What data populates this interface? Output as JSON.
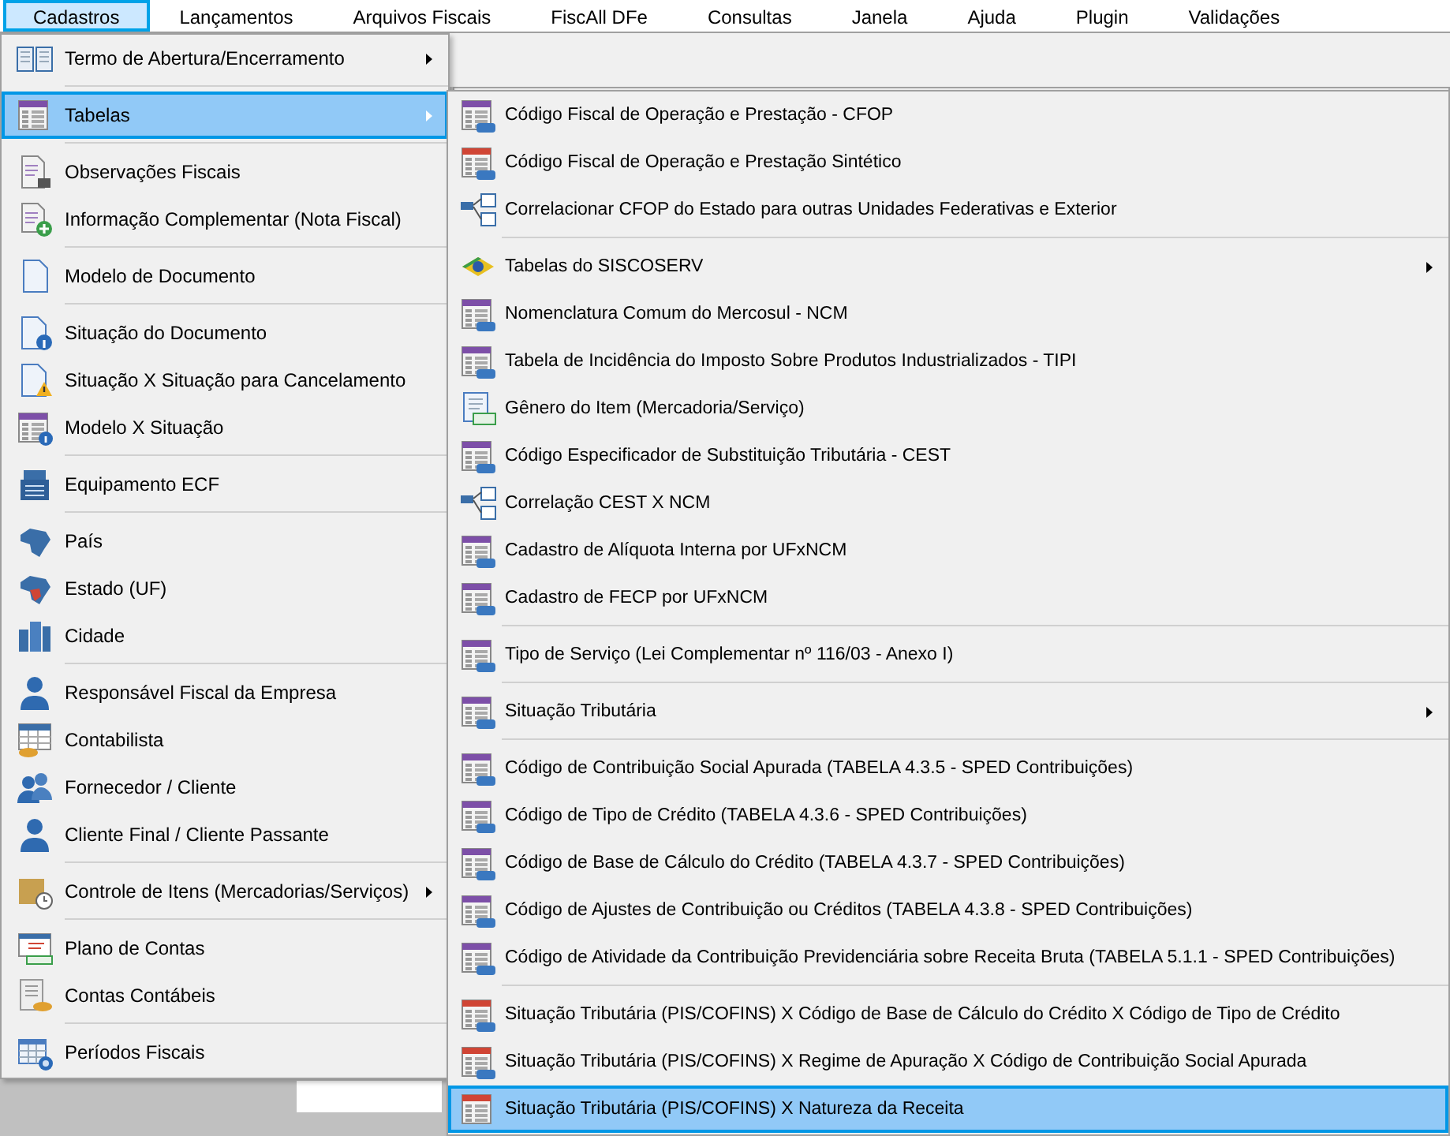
{
  "menubar": [
    {
      "label": "Cadastros",
      "selected": true
    },
    {
      "label": "Lançamentos",
      "selected": false
    },
    {
      "label": "Arquivos Fiscais",
      "selected": false
    },
    {
      "label": "FiscAll DFe",
      "selected": false
    },
    {
      "label": "Consultas",
      "selected": false
    },
    {
      "label": "Janela",
      "selected": false
    },
    {
      "label": "Ajuda",
      "selected": false
    },
    {
      "label": "Plugin",
      "selected": false
    },
    {
      "label": "Validações",
      "selected": false
    }
  ],
  "menu": {
    "items": [
      {
        "kind": "item",
        "label": "Termo de Abertura/Encerramento",
        "has_submenu": true,
        "selected": false
      },
      {
        "kind": "separator"
      },
      {
        "kind": "item",
        "label": "Tabelas",
        "has_submenu": true,
        "selected": true
      },
      {
        "kind": "separator"
      },
      {
        "kind": "item",
        "label": "Observações Fiscais",
        "has_submenu": false,
        "selected": false
      },
      {
        "kind": "item",
        "label": "Informação Complementar (Nota Fiscal)",
        "has_submenu": false,
        "selected": false
      },
      {
        "kind": "separator"
      },
      {
        "kind": "item",
        "label": "Modelo de Documento",
        "has_submenu": false,
        "selected": false
      },
      {
        "kind": "separator"
      },
      {
        "kind": "item",
        "label": "Situação do Documento",
        "has_submenu": false,
        "selected": false
      },
      {
        "kind": "item",
        "label": "Situação X Situação para Cancelamento",
        "has_submenu": false,
        "selected": false
      },
      {
        "kind": "item",
        "label": "Modelo X Situação",
        "has_submenu": false,
        "selected": false
      },
      {
        "kind": "separator"
      },
      {
        "kind": "item",
        "label": "Equipamento ECF",
        "has_submenu": false,
        "selected": false
      },
      {
        "kind": "separator"
      },
      {
        "kind": "item",
        "label": "País",
        "has_submenu": false,
        "selected": false
      },
      {
        "kind": "item",
        "label": "Estado (UF)",
        "has_submenu": false,
        "selected": false
      },
      {
        "kind": "item",
        "label": "Cidade",
        "has_submenu": false,
        "selected": false
      },
      {
        "kind": "separator"
      },
      {
        "kind": "item",
        "label": "Responsável Fiscal da Empresa",
        "has_submenu": false,
        "selected": false
      },
      {
        "kind": "item",
        "label": "Contabilista",
        "has_submenu": false,
        "selected": false
      },
      {
        "kind": "item",
        "label": "Fornecedor / Cliente",
        "has_submenu": false,
        "selected": false
      },
      {
        "kind": "item",
        "label": "Cliente Final / Cliente Passante",
        "has_submenu": false,
        "selected": false
      },
      {
        "kind": "separator"
      },
      {
        "kind": "item",
        "label": "Controle de Itens (Mercadorias/Serviços)",
        "has_submenu": true,
        "selected": false
      },
      {
        "kind": "separator"
      },
      {
        "kind": "item",
        "label": "Plano de Contas",
        "has_submenu": false,
        "selected": false
      },
      {
        "kind": "item",
        "label": "Contas Contábeis",
        "has_submenu": false,
        "selected": false
      },
      {
        "kind": "separator"
      },
      {
        "kind": "item",
        "label": "Períodos Fiscais",
        "has_submenu": false,
        "selected": false
      }
    ]
  },
  "submenu": {
    "items": [
      {
        "kind": "item",
        "label": "Código Fiscal de Operação e Prestação - CFOP",
        "has_submenu": false,
        "selected": false
      },
      {
        "kind": "item",
        "label": "Código Fiscal de Operação e Prestação Sintético",
        "has_submenu": false,
        "selected": false
      },
      {
        "kind": "item",
        "label": "Correlacionar CFOP do Estado para outras Unidades Federativas e Exterior",
        "has_submenu": false,
        "selected": false
      },
      {
        "kind": "separator"
      },
      {
        "kind": "item",
        "label": "Tabelas do SISCOSERV",
        "has_submenu": true,
        "selected": false
      },
      {
        "kind": "item",
        "label": "Nomenclatura Comum do Mercosul  - NCM",
        "has_submenu": false,
        "selected": false
      },
      {
        "kind": "item",
        "label": "Tabela de Incidência do Imposto Sobre Produtos Industrializados - TIPI",
        "has_submenu": false,
        "selected": false
      },
      {
        "kind": "item",
        "label": "Gênero do Item (Mercadoria/Serviço)",
        "has_submenu": false,
        "selected": false
      },
      {
        "kind": "item",
        "label": "Código Especificador de Substituição Tributária - CEST",
        "has_submenu": false,
        "selected": false
      },
      {
        "kind": "item",
        "label": "Correlação CEST X NCM",
        "has_submenu": false,
        "selected": false
      },
      {
        "kind": "item",
        "label": "Cadastro de Alíquota Interna por UFxNCM",
        "has_submenu": false,
        "selected": false
      },
      {
        "kind": "item",
        "label": "Cadastro de FECP por UFxNCM",
        "has_submenu": false,
        "selected": false
      },
      {
        "kind": "separator"
      },
      {
        "kind": "item",
        "label": "Tipo de Serviço (Lei Complementar nº 116/03 - Anexo I)",
        "has_submenu": false,
        "selected": false
      },
      {
        "kind": "separator"
      },
      {
        "kind": "item",
        "label": "Situação Tributária",
        "has_submenu": true,
        "selected": false
      },
      {
        "kind": "separator"
      },
      {
        "kind": "item",
        "label": "Código de Contribuição Social Apurada (TABELA 4.3.5 - SPED Contribuições)",
        "has_submenu": false,
        "selected": false
      },
      {
        "kind": "item",
        "label": "Código de Tipo de Crédito (TABELA 4.3.6 - SPED Contribuições)",
        "has_submenu": false,
        "selected": false
      },
      {
        "kind": "item",
        "label": "Código de Base de Cálculo do Crédito (TABELA 4.3.7 - SPED Contribuições)",
        "has_submenu": false,
        "selected": false
      },
      {
        "kind": "item",
        "label": "Código de Ajustes de Contribuição ou Créditos (TABELA 4.3.8 - SPED Contribuições)",
        "has_submenu": false,
        "selected": false
      },
      {
        "kind": "item",
        "label": "Código de Atividade da Contribuição Previdenciária sobre Receita Bruta (TABELA 5.1.1 - SPED Contribuições)",
        "has_submenu": false,
        "selected": false
      },
      {
        "kind": "separator"
      },
      {
        "kind": "item",
        "label": "Situação Tributária (PIS/COFINS)  X  Código de Base de Cálculo do Crédito  X  Código de Tipo de Crédito",
        "has_submenu": false,
        "selected": false
      },
      {
        "kind": "item",
        "label": "Situação Tributária (PIS/COFINS)  X  Regime de Apuração  X  Código de Contribuição Social Apurada",
        "has_submenu": false,
        "selected": false
      },
      {
        "kind": "item",
        "label": "Situação Tributária (PIS/COFINS)  X  Natureza da Receita",
        "has_submenu": false,
        "selected": true
      }
    ]
  }
}
